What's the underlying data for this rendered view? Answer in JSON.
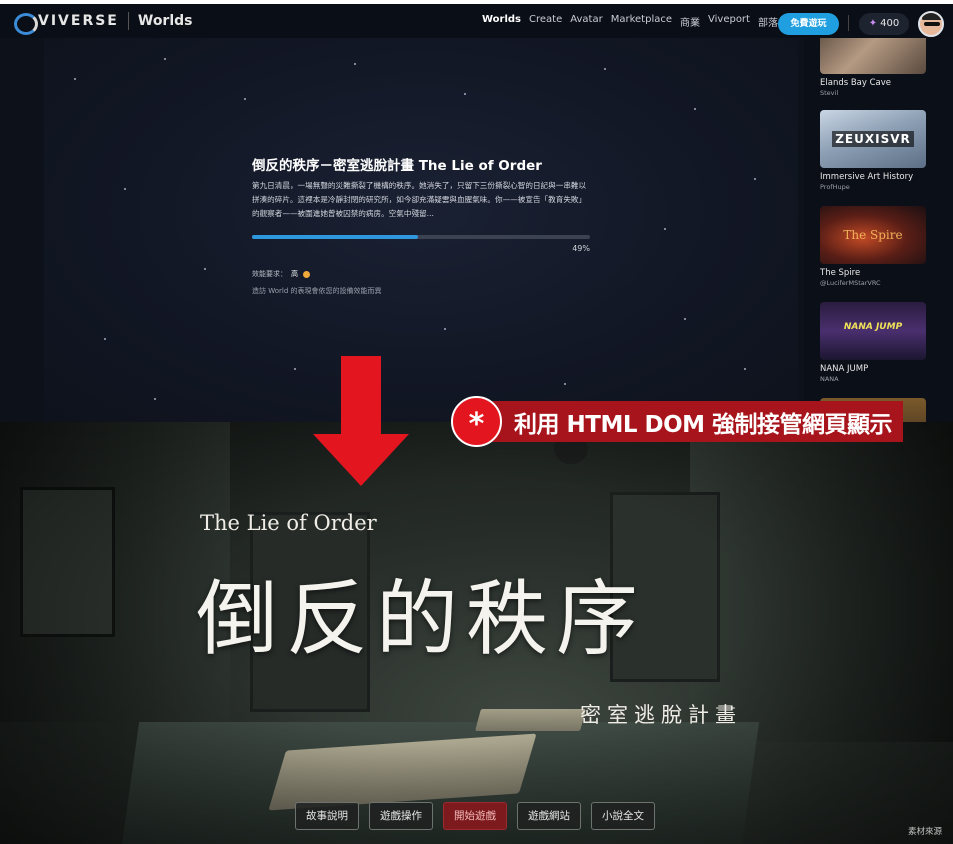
{
  "browser": {
    "brand": "VIVERSE",
    "brand_section": "Worlds",
    "nav": [
      "Worlds",
      "Create",
      "Avatar",
      "Marketplace",
      "商業",
      "Viveport",
      "部落格"
    ],
    "cta_label": "免費遊玩",
    "points_icon": "sparkle-icon",
    "points": "400"
  },
  "loader": {
    "title": "倒反的秩序－密室逃脫計畫 The Lie of Order",
    "description": "第九日清晨，一場無聲的災難撕裂了機構的秩序。她消失了，只留下三份撕裂心智的日記與一串難以拼湊的碎片。這裡本是冷靜封閉的研究所，如今卻充滿疑雲與血腥氣味。你——被宣告「教育失敗」的觀察者——被圍進她曾被囚禁的病房。空氣中殘留...",
    "progress_percent": 49,
    "progress_label": "49%",
    "requirement_label": "效能要求：",
    "requirement_value": "高",
    "requirement_note": "造訪 World 的表現會依您的設備效能而異"
  },
  "worlds": [
    {
      "title": "Elands Bay Cave",
      "author": "Stevil"
    },
    {
      "title": "Immersive Art History",
      "author": "ProfHupe",
      "thumb_text": "ZEUXISVR"
    },
    {
      "title": "The Spire",
      "author": "@LuciferMStarVRC",
      "thumb_text": "The Spire"
    },
    {
      "title": "NANA JUMP",
      "author": "NANA",
      "thumb_text": "NANA JUMP"
    }
  ],
  "annotation": {
    "symbol": "*",
    "text": "利用 HTML DOM 強制接管網頁顯示"
  },
  "game": {
    "subtitle_en": "The Lie of Order",
    "title_zh": "倒反的秩序",
    "tagline_zh": "密室逃脫計畫",
    "menu": [
      "故事說明",
      "遊戲操作",
      "開始遊戲",
      "遊戲網站",
      "小說全文"
    ],
    "credit": "素材來源"
  },
  "colors": {
    "accent_blue": "#2f97dd",
    "cta_blue": "#1f9fe0",
    "annotation_red": "#a8141b",
    "primary_menu_red": "#7d1a1e"
  }
}
